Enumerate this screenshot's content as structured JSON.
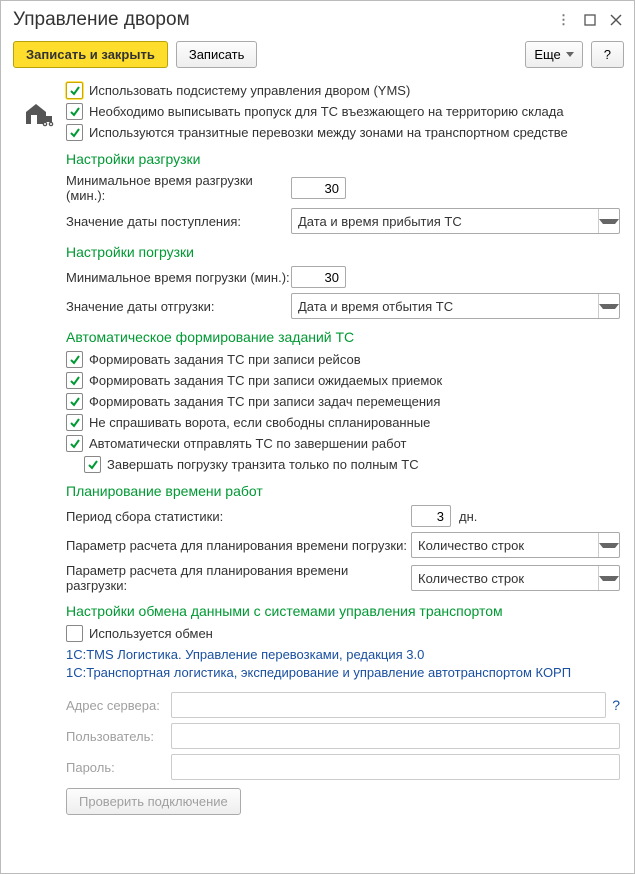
{
  "window": {
    "title": "Управление двором"
  },
  "toolbar": {
    "save_close": "Записать и закрыть",
    "save": "Записать",
    "more": "Еще",
    "help": "?"
  },
  "main_checks": {
    "use_yms": "Использовать подсистему управления двором (YMS)",
    "pass": "Необходимо выписывать пропуск для ТС въезжающего  на территорию склада",
    "transit": "Используются транзитные перевозки между зонами на транспортном средстве"
  },
  "unload": {
    "title": "Настройки разгрузки",
    "min_time_label": "Минимальное время разгрузки (мин.):",
    "min_time_value": "30",
    "date_label": "Значение даты поступления:",
    "date_value": "Дата и время прибытия ТС"
  },
  "load": {
    "title": "Настройки погрузки",
    "min_time_label": "Минимальное время погрузки (мин.):",
    "min_time_value": "30",
    "date_label": "Значение даты отгрузки:",
    "date_value": "Дата и время отбытия ТС"
  },
  "autoform": {
    "title": "Автоматическое формирование заданий ТС",
    "c1": "Формировать задания ТС при записи рейсов",
    "c2": "Формировать задания ТС при записи ожидаемых приемок",
    "c3": "Формировать задания ТС при записи задач перемещения",
    "c4": "Не спрашивать ворота, если свободны спланированные",
    "c5": "Автоматически отправлять ТС по завершении работ",
    "c6": "Завершать погрузку транзита только по полным ТС"
  },
  "plan": {
    "title": "Планирование времени работ",
    "period_label": "Период сбора статистики:",
    "period_value": "3",
    "period_unit": "дн.",
    "param_load": "Параметр расчета для планирования времени погрузки:",
    "param_unload": "Параметр расчета для планирования времени разгрузки:",
    "param_value": "Количество строк"
  },
  "exchange": {
    "title": "Настройки обмена данными с системами управления транспортом",
    "use": "Используется обмен",
    "link1": "1С:TMS Логистика. Управление перевозками, редакция 3.0",
    "link2": "1С:Транспортная логистика, экспедирование и управление автотранспортом КОРП",
    "server": "Адрес сервера:",
    "user": "Пользователь:",
    "password": "Пароль:",
    "test": "Проверить подключение"
  },
  "icons": {
    "check_color": "#009933"
  }
}
